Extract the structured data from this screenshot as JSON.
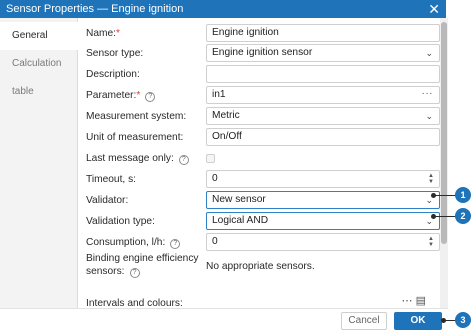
{
  "window": {
    "title": "Sensor Properties — Engine ignition",
    "close_icon": "close-icon"
  },
  "sidebar": {
    "tabs": [
      {
        "label": "General"
      },
      {
        "label": "Calculation table"
      }
    ]
  },
  "form": {
    "name_label": "Name:",
    "name_required": "*",
    "name_value": "Engine ignition",
    "sensor_type_label": "Sensor type:",
    "sensor_type_value": "Engine ignition sensor",
    "description_label": "Description:",
    "description_value": "",
    "parameter_label": "Parameter:",
    "parameter_required": "*",
    "parameter_value": "in1",
    "parameter_more": "···",
    "measurement_system_label": "Measurement system:",
    "measurement_system_value": "Metric",
    "unit_label": "Unit of measurement:",
    "unit_value": "On/Off",
    "last_message_label": "Last message only:",
    "timeout_label": "Timeout, s:",
    "timeout_value": "0",
    "validator_label": "Validator:",
    "validator_value": "New sensor",
    "validation_type_label": "Validation type:",
    "validation_type_value": "Logical AND",
    "consumption_label": "Consumption, l/h:",
    "consumption_value": "0",
    "binding_label_line1": "Binding engine efficiency",
    "binding_label_line2": "sensors:",
    "binding_value": "No appropriate sensors.",
    "intervals_label": "Intervals and colours:"
  },
  "help_glyph": "?",
  "footer": {
    "cancel_label": "Cancel",
    "ok_label": "OK"
  },
  "callouts": [
    "1",
    "2",
    "3"
  ]
}
